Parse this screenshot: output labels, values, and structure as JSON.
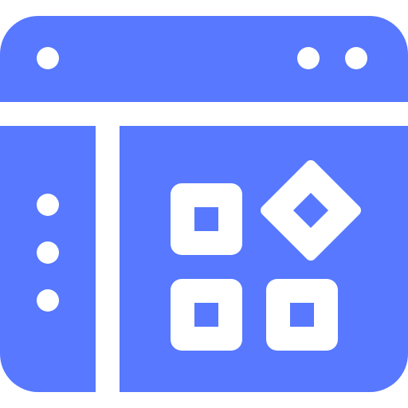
{
  "icon": {
    "name": "app-window-widgets-icon",
    "primary_color": "#5778FF",
    "foreground_color": "#FFFFFF",
    "background_color": "#FFFFFF"
  },
  "window": {
    "title_bar_dots_left": 1,
    "title_bar_dots_right": 2
  },
  "sidebar": {
    "item_count": 3
  },
  "content": {
    "widgets": [
      {
        "name": "square-widget"
      },
      {
        "name": "diamond-widget"
      },
      {
        "name": "square-widget"
      },
      {
        "name": "square-widget"
      }
    ]
  }
}
